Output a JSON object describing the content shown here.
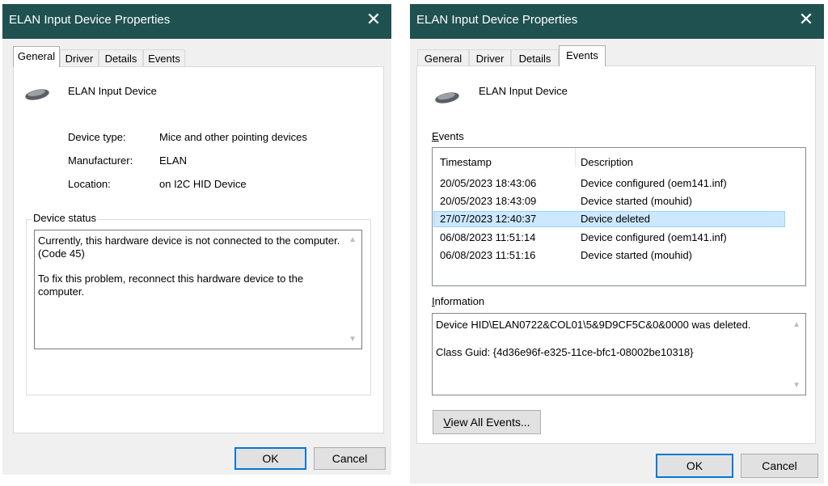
{
  "left_window": {
    "title": "ELAN Input Device Properties",
    "close_glyph": "✕",
    "tabs": [
      {
        "label": "General"
      },
      {
        "label": "Driver"
      },
      {
        "label": "Details"
      },
      {
        "label": "Events"
      }
    ],
    "active_tab": "General",
    "device_name": "ELAN Input Device",
    "icon": "mouse-icon",
    "properties": {
      "type_label": "Device type:",
      "type_value": "Mice and other pointing devices",
      "manufacturer_label": "Manufacturer:",
      "manufacturer_value": "ELAN",
      "location_label": "Location:",
      "location_value": "on I2C HID Device"
    },
    "device_status": {
      "label": "Device status",
      "line1": "Currently, this hardware device is not connected to the computer.",
      "line2": "(Code 45)",
      "line3": "To fix this problem, reconnect this hardware device to the",
      "line4": "computer."
    },
    "ok_label": "OK",
    "cancel_label": "Cancel"
  },
  "right_window": {
    "title": "ELAN Input Device Properties",
    "close_glyph": "✕",
    "tabs": [
      {
        "label": "General"
      },
      {
        "label": "Driver"
      },
      {
        "label": "Details"
      },
      {
        "label": "Events"
      }
    ],
    "active_tab": "Events",
    "device_name": "ELAN Input Device",
    "icon": "mouse-icon",
    "events_label": "Events",
    "events_label_accel": "E",
    "events_label_rest": "vents",
    "columns": {
      "timestamp": "Timestamp",
      "description": "Description"
    },
    "events": [
      {
        "timestamp": "20/05/2023 18:43:06",
        "description": "Device configured (oem141.inf)"
      },
      {
        "timestamp": "20/05/2023 18:43:09",
        "description": "Device started (mouhid)"
      },
      {
        "timestamp": "27/07/2023 12:40:37",
        "description": "Device deleted"
      },
      {
        "timestamp": "06/08/2023 11:51:14",
        "description": "Device configured (oem141.inf)"
      },
      {
        "timestamp": "06/08/2023 11:51:16",
        "description": "Device started (mouhid)"
      }
    ],
    "selected_index": 2,
    "information_label": "Information",
    "information_label_accel": "I",
    "information_label_rest": "nformation",
    "information": {
      "line1": "Device HID\\ELAN0722&COL01\\5&9D9CF5C&0&0000 was deleted.",
      "line2": "Class Guid: {4d36e96f-e325-11ce-bfc1-08002be10318}"
    },
    "view_all_label": "View All Events...",
    "view_all_accel": "V",
    "view_all_rest": "iew All Events...",
    "ok_label": "OK",
    "cancel_label": "Cancel"
  },
  "colors": {
    "titlebar": "#1f5150",
    "selection": "#cce8ff",
    "dialog_bg": "#f0f0f0",
    "accent": "#0078d7"
  }
}
